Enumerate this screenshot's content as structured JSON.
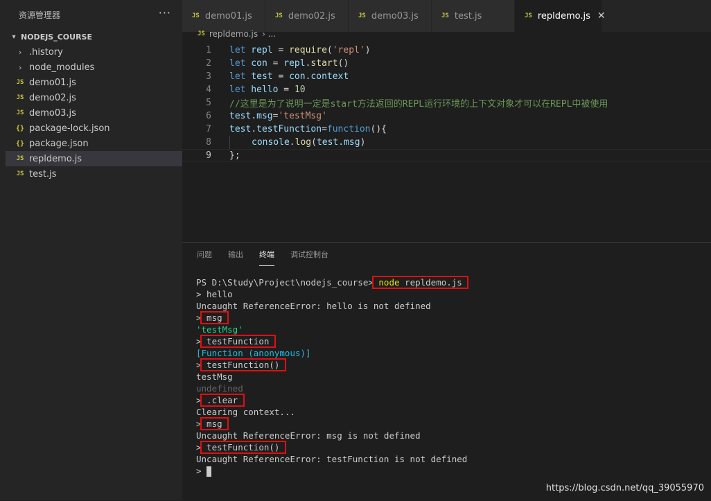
{
  "sidebar": {
    "title": "资源管理器",
    "more_label": "···",
    "section": "NODEJS_COURSE",
    "items": [
      {
        "label": ".history",
        "icon": "chevron-right-icon",
        "glyph": "›",
        "type": "folder"
      },
      {
        "label": "node_modules",
        "icon": "chevron-right-icon",
        "glyph": "›",
        "type": "folder"
      },
      {
        "label": "demo01.js",
        "icon": "js-file-icon",
        "glyph": "JS",
        "type": "js"
      },
      {
        "label": "demo02.js",
        "icon": "js-file-icon",
        "glyph": "JS",
        "type": "js"
      },
      {
        "label": "demo03.js",
        "icon": "js-file-icon",
        "glyph": "JS",
        "type": "js"
      },
      {
        "label": "package-lock.json",
        "icon": "json-file-icon",
        "glyph": "{}",
        "type": "json"
      },
      {
        "label": "package.json",
        "icon": "json-file-icon",
        "glyph": "{}",
        "type": "json"
      },
      {
        "label": "repldemo.js",
        "icon": "js-file-icon",
        "glyph": "JS",
        "type": "js",
        "selected": true
      },
      {
        "label": "test.js",
        "icon": "js-file-icon",
        "glyph": "JS",
        "type": "js"
      }
    ]
  },
  "tabs": [
    {
      "label": "demo01.js",
      "glyph": "JS"
    },
    {
      "label": "demo02.js",
      "glyph": "JS"
    },
    {
      "label": "demo03.js",
      "glyph": "JS"
    },
    {
      "label": "test.js",
      "glyph": "JS"
    },
    {
      "label": "repldemo.js",
      "glyph": "JS",
      "active": true,
      "close": "✕"
    }
  ],
  "breadcrumb": {
    "glyph": "JS",
    "file": "repldemo.js",
    "sep": "› ..."
  },
  "code": {
    "line_numbers": [
      "1",
      "2",
      "3",
      "4",
      "5",
      "6",
      "7",
      "8",
      "9"
    ],
    "l1": {
      "kw": "let",
      "var": " repl",
      "op": " = ",
      "fn": "require",
      "p1": "(",
      "str": "'repl'",
      "p2": ")"
    },
    "l2": {
      "kw": "let",
      "var": " con",
      "op": " = ",
      "obj": "repl",
      "dot": ".",
      "fn": "start",
      "p": "()"
    },
    "l3": {
      "kw": "let",
      "var": " test",
      "op": " = ",
      "obj": "con",
      "dot": ".",
      "prop": "context"
    },
    "l4": {
      "kw": "let",
      "var": " hello",
      "op": " = ",
      "num": "10"
    },
    "l5": {
      "comment": "//这里是为了说明一定是start方法返回的REPL运行环境的上下文对象才可以在REPL中被使用"
    },
    "l6": {
      "obj": "test",
      "dot": ".",
      "prop": "msg",
      "op": "=",
      "str": "'testMsg'"
    },
    "l7": {
      "obj": "test",
      "dot": ".",
      "prop": "testFunction",
      "op": "=",
      "kw": "function",
      "p": "(){"
    },
    "l8": {
      "obj": "console",
      "dot": ".",
      "fn": "log",
      "p1": "(",
      "arg": "test.msg",
      "p2": ")"
    },
    "l9": {
      "text": "};"
    }
  },
  "panel": {
    "tabs": [
      "问题",
      "输出",
      "终端",
      "调试控制台"
    ],
    "active_tab": "终端"
  },
  "terminal": {
    "prompt": "PS D:\\Study\\Project\\nodejs_course>",
    "command_word": "node",
    "command_arg": " repldemo.js",
    "lines": {
      "l2": "> hello",
      "l3": "Uncaught ReferenceError: hello is not defined",
      "l4_prompt": ">",
      "l4_cmd": " msg ",
      "l5": "'testMsg'",
      "l6_prompt": ">",
      "l6_cmd": " testFunction ",
      "l7": "[Function (anonymous)]",
      "l8_prompt": ">",
      "l8_cmd": " testFunction() ",
      "l9": "testMsg",
      "l10": "undefined",
      "l11_prompt": ">",
      "l11_cmd": " .clear ",
      "l12": "Clearing context...",
      "l13_prompt": ">",
      "l13_cmd": " msg ",
      "l14": "Uncaught ReferenceError: msg is not defined",
      "l15_prompt": ">",
      "l15_cmd": " testFunction() ",
      "l16": "Uncaught ReferenceError: testFunction is not defined",
      "l17_prompt": "> "
    }
  },
  "watermark": "https://blog.csdn.net/qq_39055970",
  "colors": {
    "highlight_box": "#e01010",
    "js_icon": "#cbcb41"
  }
}
